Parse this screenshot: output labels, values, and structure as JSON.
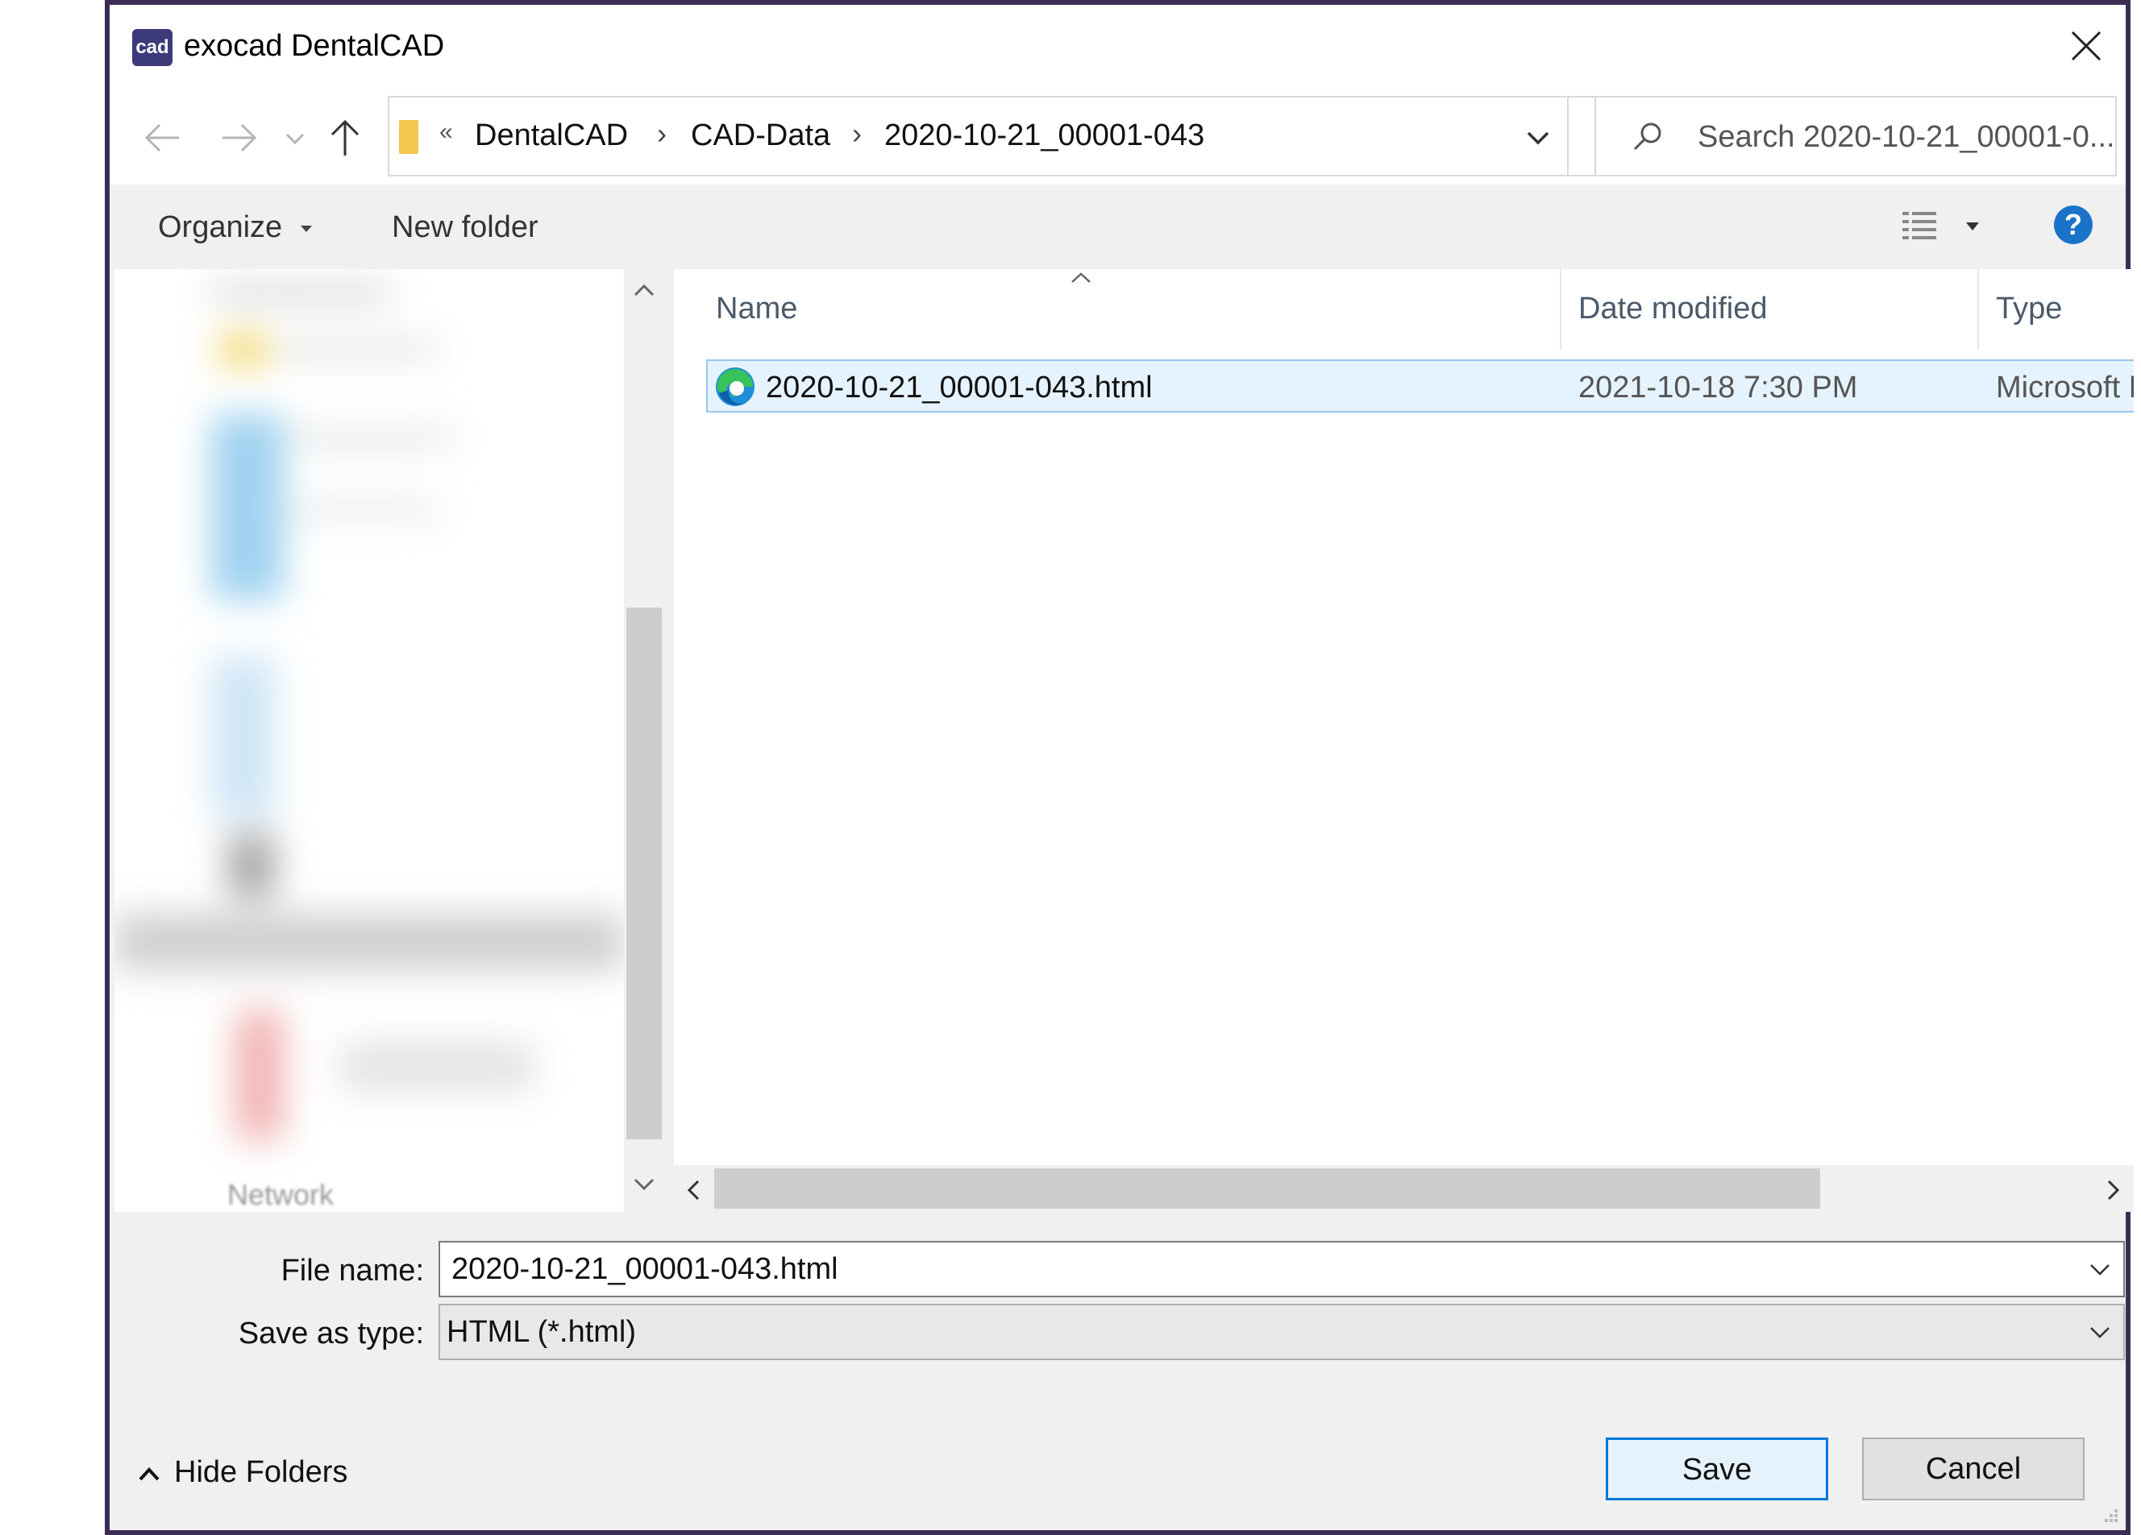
{
  "window": {
    "app_icon_text": "cad",
    "title": "exocad DentalCAD"
  },
  "address_bar": {
    "overflow_glyph": "«",
    "breadcrumbs": [
      "DentalCAD",
      "CAD-Data",
      "2020-10-21_00001-043"
    ],
    "separator": "›"
  },
  "search": {
    "placeholder": "Search 2020-10-21_00001-0..."
  },
  "toolbar": {
    "organize_label": "Organize",
    "new_folder_label": "New folder",
    "help_label": "?"
  },
  "nav_pane": {
    "network_label": "Network"
  },
  "file_list": {
    "columns": [
      "Name",
      "Date modified",
      "Type"
    ],
    "rows": [
      {
        "name": "2020-10-21_00001-043.html",
        "date_modified": "2021-10-18 7:30 PM",
        "type": "Microsoft Edge H",
        "icon": "edge-icon"
      }
    ]
  },
  "form": {
    "file_name_label": "File name:",
    "file_name_value": "2020-10-21_00001-043.html",
    "save_type_label": "Save as type:",
    "save_type_value": "HTML (*.html)"
  },
  "footer": {
    "hide_folders_label": "Hide Folders",
    "save_label": "Save",
    "cancel_label": "Cancel"
  },
  "colors": {
    "accent": "#0078d7",
    "selection_bg": "#e5f3ff",
    "selection_border": "#99c9ef",
    "window_border": "#3b2d55"
  }
}
